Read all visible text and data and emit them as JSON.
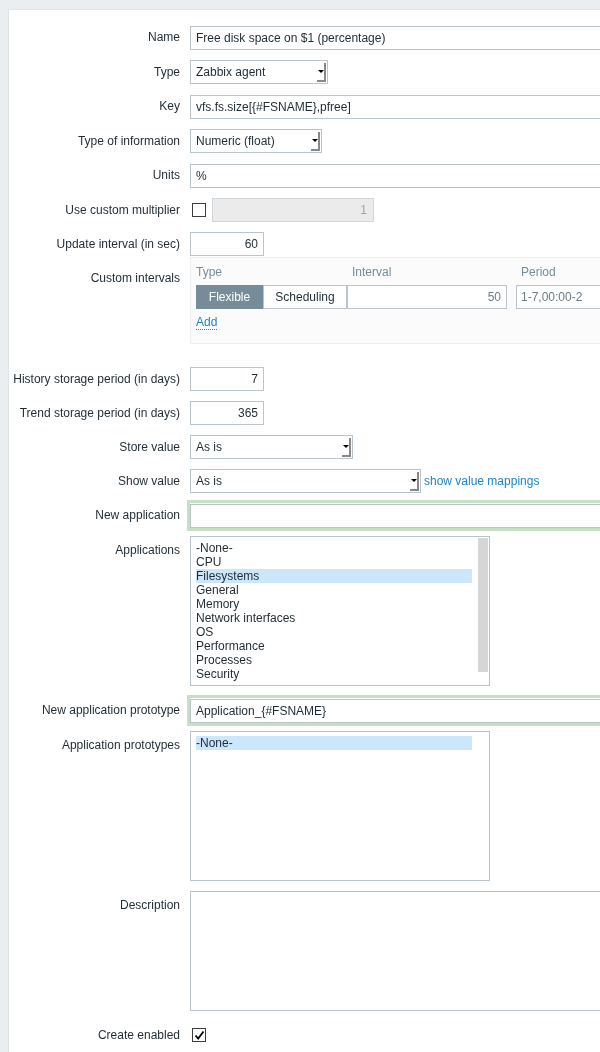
{
  "fields": [
    {
      "kind": "text",
      "label": "Name",
      "value": "Free disk space on $1 (percentage)"
    },
    {
      "kind": "select",
      "label": "Type",
      "value": "Zabbix agent"
    },
    {
      "kind": "text",
      "label": "Key",
      "value": "vfs.fs.size[{#FSNAME},pfree]"
    },
    {
      "kind": "select",
      "label": "Type of information",
      "value": "Numeric (float)"
    },
    {
      "kind": "text",
      "label": "Units",
      "value": "%"
    },
    {
      "kind": "multiplier",
      "label": "Use custom multiplier",
      "checked": false,
      "value": "1",
      "disabled": true
    },
    {
      "kind": "number",
      "label": "Update interval (in sec)",
      "value": "60"
    },
    {
      "kind": "intervals",
      "label": "Custom intervals",
      "columns": [
        "Type",
        "Interval",
        "Period"
      ],
      "modes": [
        {
          "label": "Flexible",
          "selected": true
        },
        {
          "label": "Scheduling",
          "selected": false
        }
      ],
      "interval": "50",
      "period": "1-7,00:00-2",
      "add": "Add"
    },
    {
      "kind": "number",
      "label": "History storage period (in days)",
      "value": "7"
    },
    {
      "kind": "number",
      "label": "Trend storage period (in days)",
      "value": "365"
    },
    {
      "kind": "select",
      "label": "Store value",
      "value": "As is"
    },
    {
      "kind": "select",
      "label": "Show value",
      "value": "As is",
      "link": "show value mappings"
    },
    {
      "kind": "text",
      "label": "New application",
      "highlighted": true
    },
    {
      "kind": "listbox",
      "label": "Applications",
      "scrollbar": true,
      "items": [
        {
          "label": "-None-",
          "selected": false
        },
        {
          "label": "CPU",
          "selected": false
        },
        {
          "label": "Filesystems",
          "selected": true
        },
        {
          "label": "General",
          "selected": false
        },
        {
          "label": "Memory",
          "selected": false
        },
        {
          "label": "Network interfaces",
          "selected": false
        },
        {
          "label": "OS",
          "selected": false
        },
        {
          "label": "Performance",
          "selected": false
        },
        {
          "label": "Processes",
          "selected": false
        },
        {
          "label": "Security",
          "selected": false
        }
      ]
    },
    {
      "kind": "text",
      "label": "New application prototype",
      "value": "Application_{#FSNAME}",
      "highlighted": true
    },
    {
      "kind": "listbox",
      "label": "Application prototypes",
      "items": [
        {
          "label": "-None-",
          "selected": true
        }
      ]
    },
    {
      "kind": "textarea",
      "label": "Description"
    },
    {
      "kind": "checkbox",
      "label": "Create enabled",
      "checked": true
    }
  ]
}
